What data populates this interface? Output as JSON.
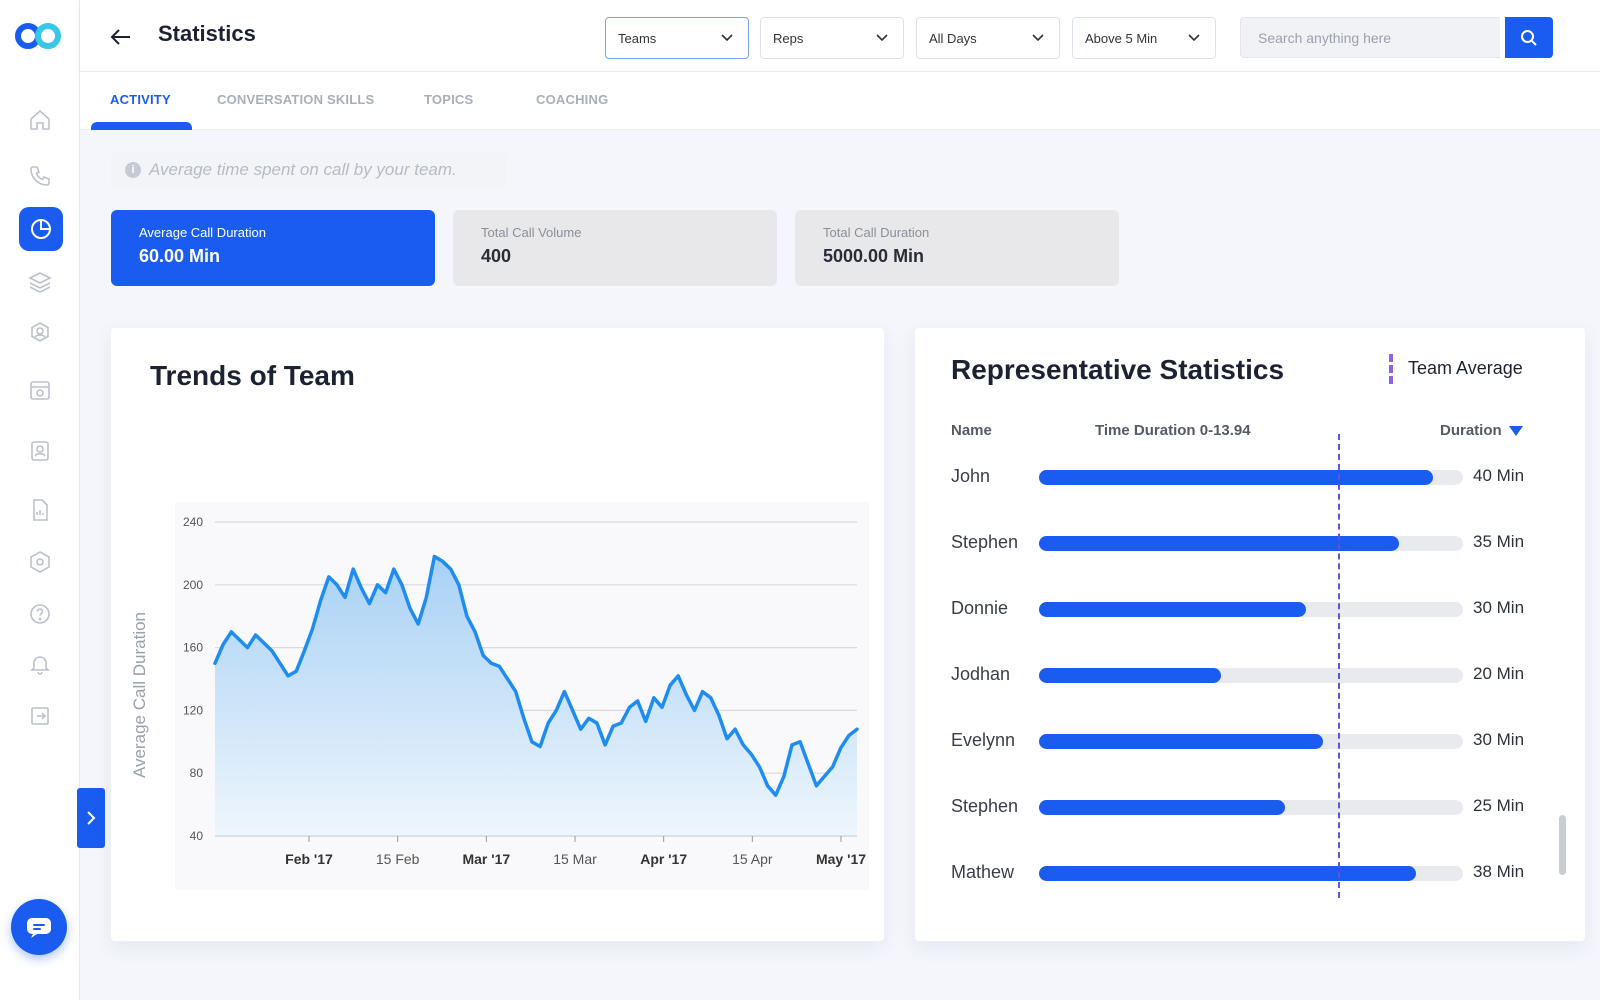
{
  "header": {
    "title": "Statistics",
    "filters": [
      {
        "label": "Teams"
      },
      {
        "label": "Reps"
      },
      {
        "label": "All Days"
      },
      {
        "label": "Above 5 Min"
      }
    ],
    "search_placeholder": "Search anything here"
  },
  "tabs": [
    {
      "label": "ACTIVITY",
      "active": true
    },
    {
      "label": "CONVERSATION SKILLS",
      "active": false
    },
    {
      "label": "TOPICS",
      "active": false
    },
    {
      "label": "COACHING",
      "active": false
    }
  ],
  "info_note": "Average time spent on call by your team.",
  "stats": [
    {
      "label": "Average Call Duration",
      "value": "60.00 Min"
    },
    {
      "label": "Total Call Volume",
      "value": "400"
    },
    {
      "label": "Total Call Duration",
      "value": "5000.00 Min"
    }
  ],
  "trends_panel": {
    "title": "Trends of Team"
  },
  "chart_data": {
    "type": "area",
    "title": "",
    "xlabel": "",
    "ylabel": "Average Call Duration",
    "ylim": [
      40,
      240
    ],
    "yticks": [
      "240",
      "200",
      "160",
      "120",
      "80",
      "40"
    ],
    "xticks": [
      "Feb '17",
      "15 Feb",
      "Mar '17",
      "15 Mar",
      "Apr '17",
      "15 Apr",
      "May '17"
    ],
    "grid": true,
    "series": [
      {
        "values": [
          150,
          162,
          170,
          165,
          160,
          168,
          163,
          158,
          150,
          142,
          145,
          158,
          172,
          190,
          205,
          200,
          192,
          210,
          198,
          188,
          200,
          195,
          210,
          200,
          185,
          175,
          192,
          218,
          215,
          210,
          200,
          180,
          170,
          155,
          150,
          148,
          140,
          132,
          115,
          100,
          97,
          112,
          120,
          132,
          120,
          108,
          115,
          112,
          98,
          110,
          112,
          122,
          126,
          113,
          128,
          122,
          136,
          142,
          130,
          120,
          132,
          128,
          117,
          102,
          108,
          98,
          92,
          84,
          72,
          66,
          78,
          98,
          100,
          86,
          72,
          78,
          84,
          96,
          104,
          108
        ]
      }
    ],
    "colors": {
      "line": "#1e8cf0",
      "fill_top": "#a8d1f5",
      "fill_bottom": "#eef6fd"
    }
  },
  "rep_panel": {
    "title": "Representative Statistics",
    "legend": "Team Average",
    "columns": {
      "name": "Name",
      "range": "Time Duration 0-13.94",
      "duration": "Duration"
    },
    "reps": [
      {
        "name": "John",
        "duration": "40 Min",
        "fill": 0.93
      },
      {
        "name": "Stephen",
        "duration": "35 Min",
        "fill": 0.85
      },
      {
        "name": "Donnie",
        "duration": "30 Min",
        "fill": 0.63
      },
      {
        "name": "Jodhan",
        "duration": "20 Min",
        "fill": 0.43
      },
      {
        "name": "Evelynn",
        "duration": "30 Min",
        "fill": 0.67
      },
      {
        "name": "Stephen",
        "duration": "25 Min",
        "fill": 0.58
      },
      {
        "name": "Mathew",
        "duration": "38 Min",
        "fill": 0.89
      }
    ],
    "team_average_fraction": 0.7
  },
  "icons": [
    "home-icon",
    "phone-icon",
    "pie-chart-icon",
    "layers-icon",
    "user-settings-icon",
    "calendar-icon",
    "contact-card-icon",
    "report-icon",
    "hexagon-settings-icon",
    "help-icon",
    "bell-icon",
    "logout-icon"
  ],
  "colors": {
    "accent": "#1a5cf0",
    "average_line": "#5a55e0"
  }
}
